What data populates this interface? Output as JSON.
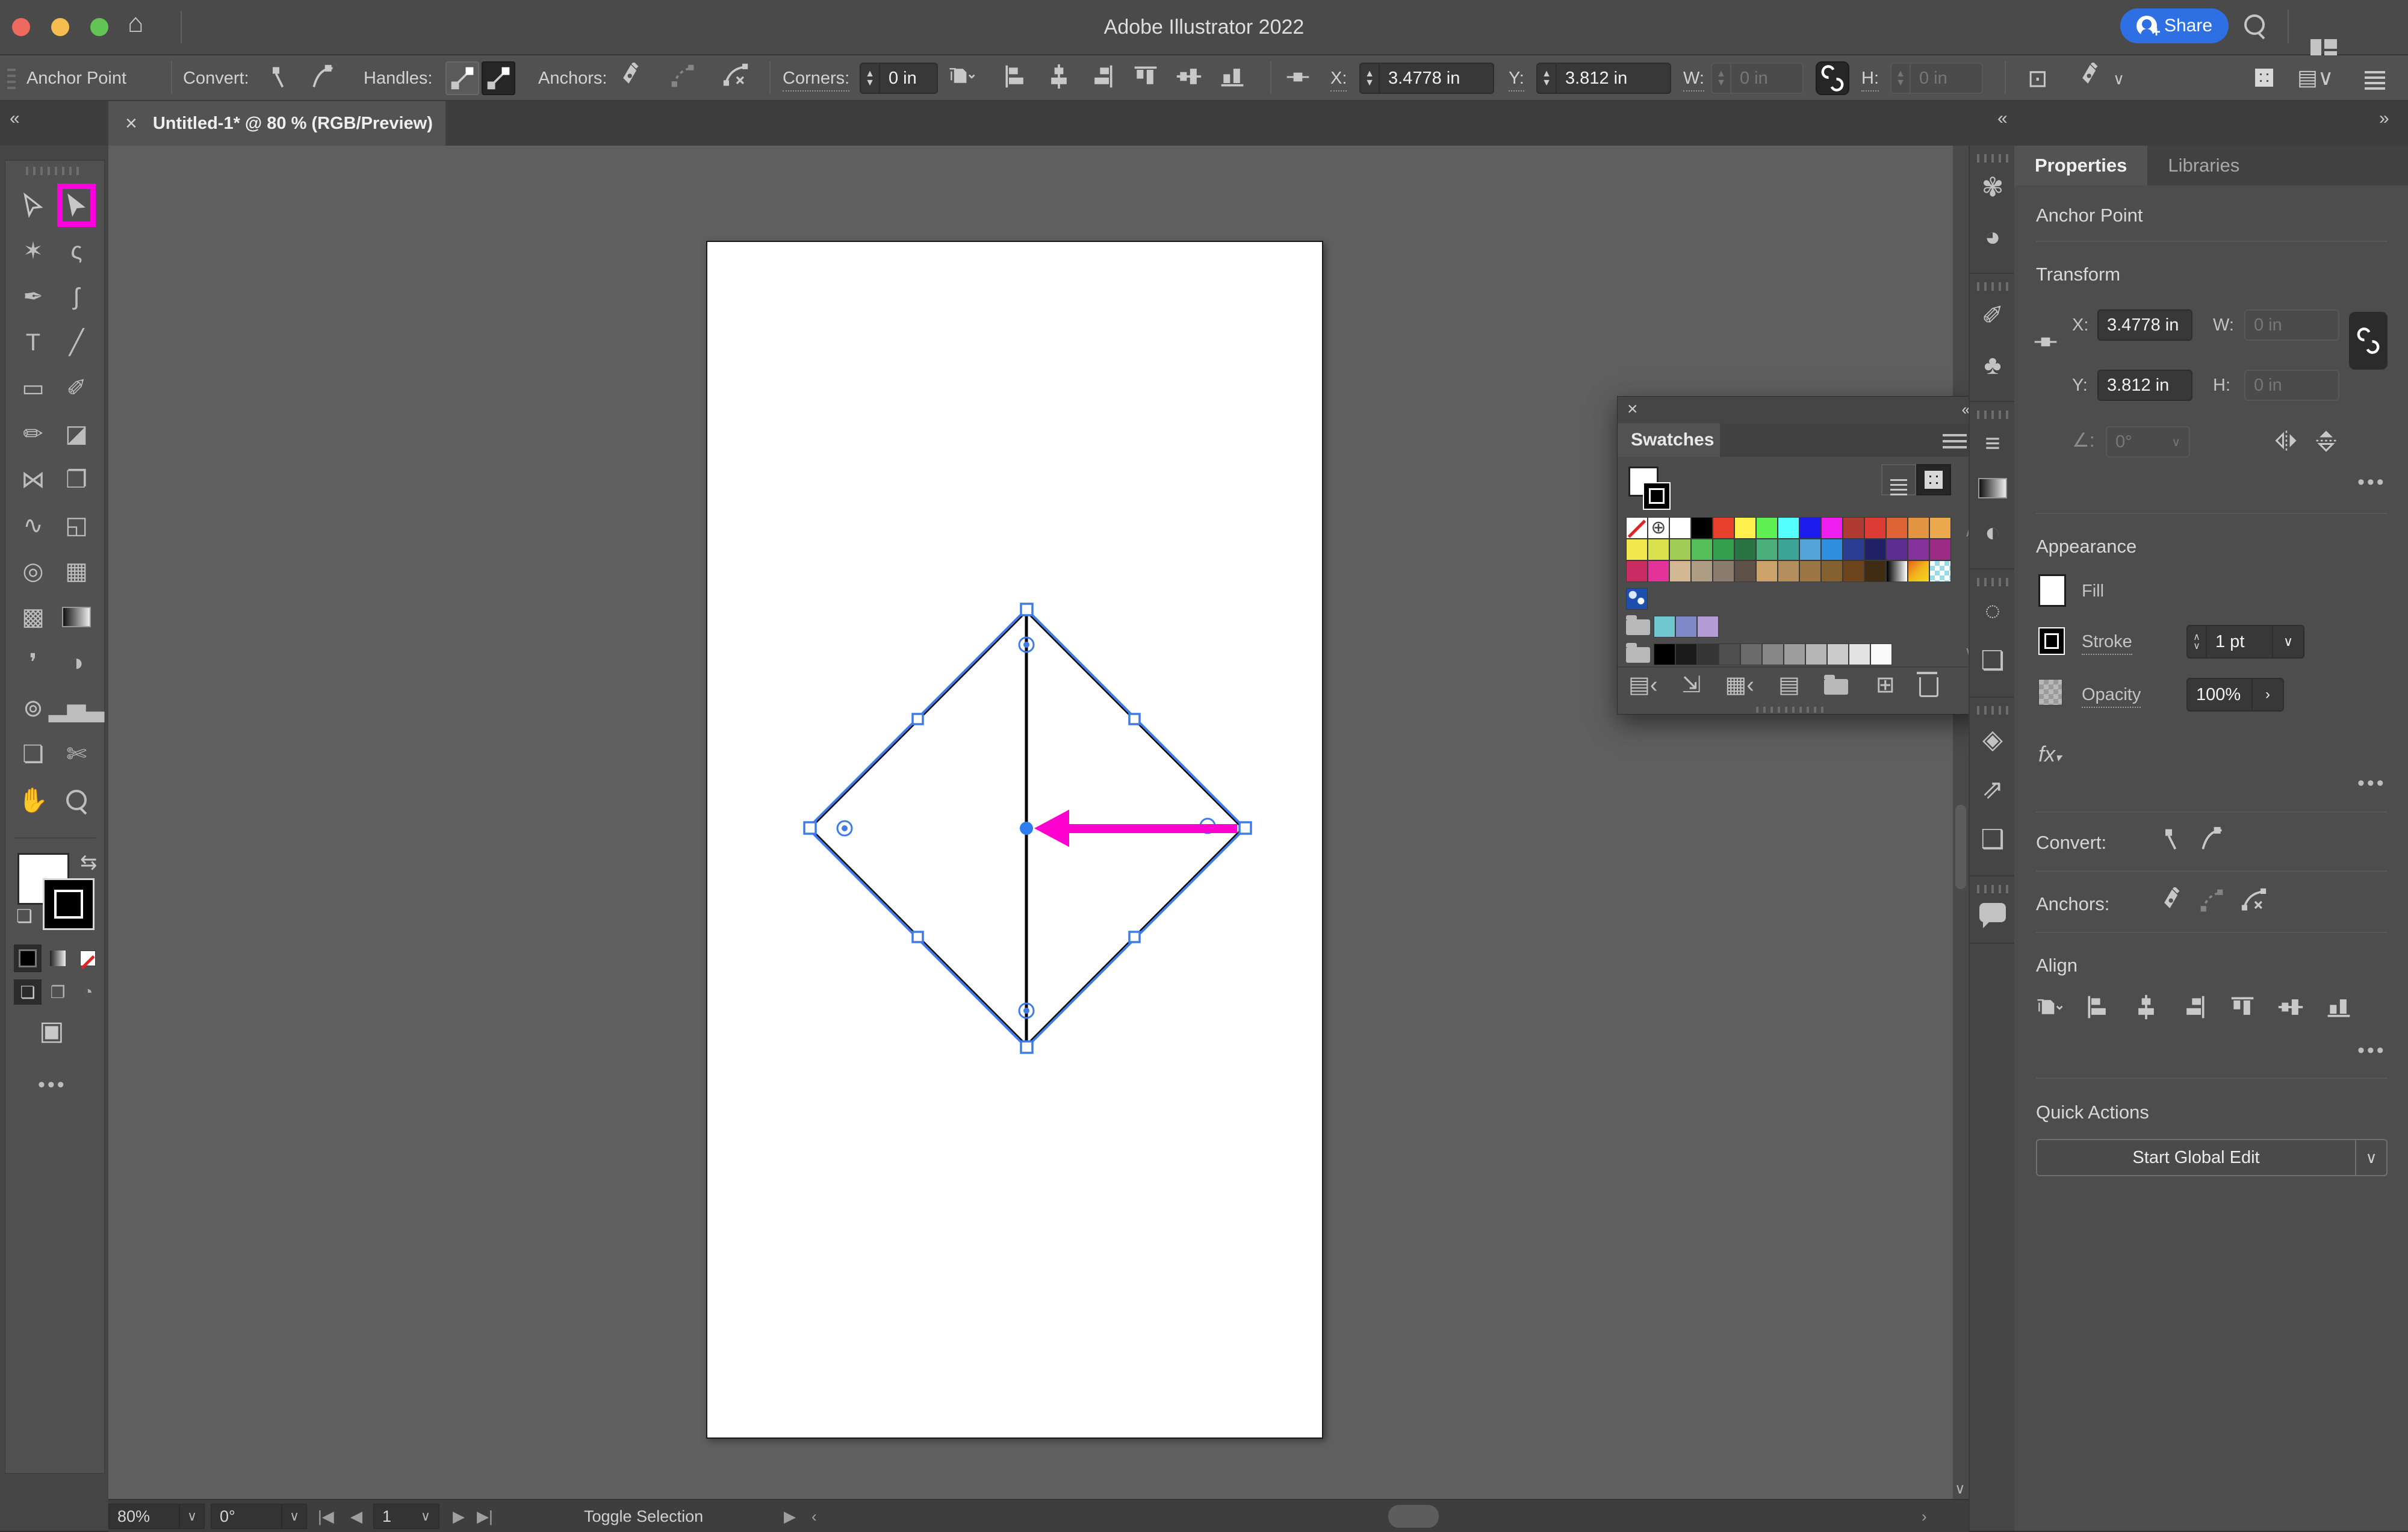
{
  "colors": {
    "accent_blue": "#2e6fe3",
    "selection_blue": "#3f7ce8",
    "magenta_arrow": "#ff00cf",
    "highlight_pink": "#ff00e0",
    "artboard_white": "#ffffff",
    "canvas_gray": "#5f5f5f"
  },
  "title_bar": {
    "title": "Adobe Illustrator 2022",
    "share_label": "Share"
  },
  "control_bar": {
    "context_label": "Anchor Point",
    "convert_label": "Convert:",
    "handles_label": "Handles:",
    "anchors_label": "Anchors:",
    "corners_label": "Corners:",
    "corners_value": "0 in",
    "x_label": "X:",
    "x_value": "3.4778 in",
    "y_label": "Y:",
    "y_value": "3.812 in",
    "w_label": "W:",
    "w_value": "0 in",
    "h_label": "H:",
    "h_value": "0 in",
    "align_icons": [
      "align-left",
      "align-hcenter",
      "align-right",
      "align-top",
      "align-vcenter",
      "align-bottom"
    ]
  },
  "tab": {
    "close": "×",
    "title": "Untitled-1* @ 80 % (RGB/Preview)"
  },
  "tools": [
    {
      "name": "selection-tool",
      "svg": "cursor-outline"
    },
    {
      "name": "direct-selection-tool",
      "svg": "cursor-filled",
      "hl": true
    },
    {
      "name": "magic-wand-tool",
      "glyph": "✶"
    },
    {
      "name": "lasso-tool",
      "glyph": "ς"
    },
    {
      "name": "pen-tool",
      "glyph": "✒"
    },
    {
      "name": "curvature-tool",
      "glyph": "ʃ"
    },
    {
      "name": "type-tool",
      "glyph": "T"
    },
    {
      "name": "line-segment-tool",
      "glyph": "╱"
    },
    {
      "name": "rectangle-tool",
      "glyph": "▭"
    },
    {
      "name": "paintbrush-tool",
      "glyph": "✐"
    },
    {
      "name": "shaper-tool",
      "glyph": "✏"
    },
    {
      "name": "eraser-tool",
      "glyph": "◪"
    },
    {
      "name": "reflect-tool",
      "glyph": "⋈"
    },
    {
      "name": "scale-tool",
      "glyph": "❐"
    },
    {
      "name": "width-tool",
      "glyph": "∿"
    },
    {
      "name": "free-transform-tool",
      "glyph": "◱"
    },
    {
      "name": "shape-builder-tool",
      "glyph": "◎"
    },
    {
      "name": "perspective-grid-tool",
      "glyph": "▦"
    },
    {
      "name": "mesh-tool",
      "glyph": "▩"
    },
    {
      "name": "gradient-tool",
      "glyph": "css-gradient"
    },
    {
      "name": "eyedropper-tool",
      "glyph": "❜"
    },
    {
      "name": "blend-tool",
      "glyph": "◑"
    },
    {
      "name": "symbol-sprayer-tool",
      "glyph": "⊚"
    },
    {
      "name": "column-graph-tool",
      "glyph": "▂▅▃"
    },
    {
      "name": "artboard-tool",
      "glyph": "❏"
    },
    {
      "name": "slice-tool",
      "glyph": "✄"
    },
    {
      "name": "hand-tool",
      "glyph": "✋"
    },
    {
      "name": "zoom-tool",
      "glyph": "css-lens"
    }
  ],
  "swatches_panel": {
    "tab": "Swatches",
    "rows": [
      [
        "none",
        "reg",
        "#ffffff",
        "#000000",
        "#e8402d",
        "#fff04d",
        "#5ff052",
        "#55ffff",
        "#1b1bed",
        "#f01df0",
        "#ae3a32",
        "#dd3b35",
        "#de6437",
        "#e39440",
        "#eda94e"
      ],
      [
        "#f2e94e",
        "#d9e14d",
        "#a0cd54",
        "#56bf59",
        "#33a04f",
        "#2a7342",
        "#4cb07c",
        "#3ca495",
        "#54a4db",
        "#2f8edd",
        "#2c3c90",
        "#202167",
        "#5c2e91",
        "#85329d",
        "#9c2c85"
      ],
      [
        "#ca2b63",
        "#e43398",
        "#d3b896",
        "#ae9c84",
        "#8b7d6e",
        "#5e5147",
        "#caa26a",
        "#b38f5f",
        "#9b7544",
        "#846130",
        "#6c451d",
        "#402b13",
        "grad-bw",
        "grad-or",
        "checker"
      ],
      [
        "pattern"
      ],
      [
        "folder",
        "#71c7cf",
        "#7e89c9",
        "#b39cd4"
      ],
      [
        "folder",
        "#000000",
        "#1b1b1b",
        "#363636",
        "#4f4f4f",
        "#6b6b6b",
        "#868686",
        "#9e9e9e",
        "#b5b5b5",
        "#cbcbcb",
        "#e3e3e3",
        "#fafafa"
      ]
    ],
    "footer_icons": [
      {
        "name": "swatch-libraries-menu-icon",
        "glyph": "▤‹"
      },
      {
        "name": "add-to-library-icon",
        "glyph": "⇲"
      },
      {
        "name": "show-swatch-kinds-icon",
        "glyph": "▦‹"
      },
      {
        "name": "swatch-options-icon",
        "glyph": "▤"
      },
      {
        "name": "new-color-group-icon",
        "glyph": "folder"
      },
      {
        "name": "new-swatch-icon",
        "glyph": "⊞"
      },
      {
        "name": "delete-swatch-icon",
        "glyph": "trash"
      }
    ]
  },
  "right_dock": {
    "groups": [
      {
        "items": [
          {
            "name": "color-panel-icon",
            "glyph": "✾"
          },
          {
            "name": "color-guide-panel-icon",
            "glyph": "◕"
          }
        ]
      },
      {
        "items": [
          {
            "name": "brushes-panel-icon",
            "glyph": "✐"
          },
          {
            "name": "symbols-panel-icon",
            "glyph": "♣"
          }
        ]
      },
      {
        "items": [
          {
            "name": "stroke-panel-icon",
            "glyph": "≡"
          },
          {
            "name": "gradient-panel-icon",
            "glyph": "css-gradient"
          },
          {
            "name": "transparency-panel-icon",
            "glyph": "◐"
          }
        ]
      },
      {
        "items": [
          {
            "name": "selection-panel-icon",
            "glyph": "◌"
          },
          {
            "name": "artboards-panel-icon",
            "glyph": "❏"
          }
        ]
      },
      {
        "items": [
          {
            "name": "layers-panel-icon",
            "glyph": "◈"
          },
          {
            "name": "export-panel-icon",
            "glyph": "⇗"
          },
          {
            "name": "asset-export-panel-icon",
            "glyph": "❑"
          }
        ]
      },
      {
        "items": [
          {
            "name": "comments-panel-icon",
            "glyph": "bubble"
          }
        ]
      }
    ]
  },
  "properties": {
    "tabs": [
      {
        "label": "Properties",
        "active": true
      },
      {
        "label": "Libraries",
        "active": false
      }
    ],
    "context_title": "Anchor Point",
    "transform": {
      "title": "Transform",
      "x_label": "X:",
      "x_value": "3.4778 in",
      "y_label": "Y:",
      "y_value": "3.812 in",
      "w_label": "W:",
      "w_value": "0 in",
      "h_label": "H:",
      "h_value": "0 in",
      "angle_value": "0°"
    },
    "appearance": {
      "title": "Appearance",
      "fill_label": "Fill",
      "stroke_label": "Stroke",
      "stroke_value": "1 pt",
      "opacity_label": "Opacity",
      "opacity_value": "100%",
      "fx_label": "fx"
    },
    "convert_label": "Convert:",
    "anchors_label": "Anchors:",
    "align": {
      "title": "Align",
      "icons": [
        "artboard-align",
        "align-left",
        "align-hcenter",
        "align-right",
        "align-top",
        "align-vcenter",
        "align-bottom"
      ]
    },
    "quick_actions": {
      "title": "Quick Actions",
      "button_label": "Start Global Edit"
    }
  },
  "status_bar": {
    "zoom": "80%",
    "rotation": "0°",
    "artboard_number": "1",
    "selection_label": "Toggle Selection"
  }
}
